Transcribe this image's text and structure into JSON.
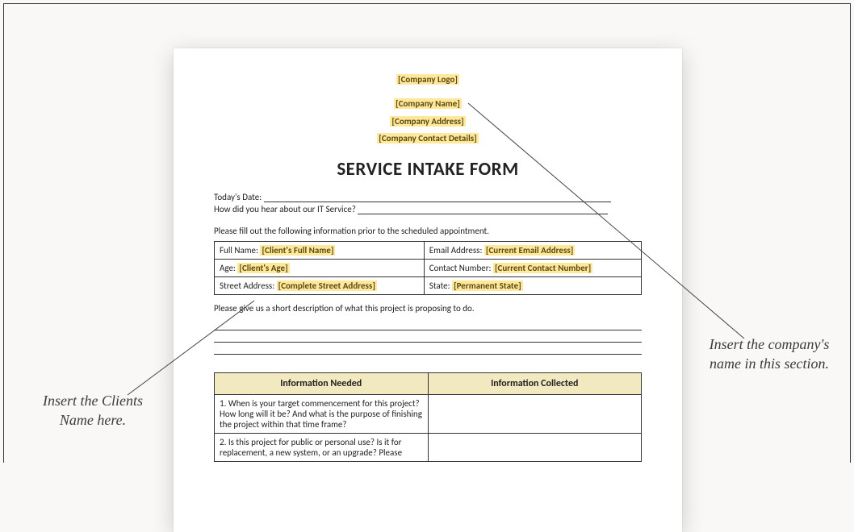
{
  "header": {
    "logo_placeholder": "[Company Logo]",
    "name_placeholder": "[Company Name]",
    "address_placeholder": "[Company Address]",
    "contact_placeholder": "[Company Contact Details]"
  },
  "title": "SERVICE INTAKE FORM",
  "intro": {
    "date_label": "Today's Date:",
    "hear_label": "How did you hear about our IT Service?",
    "fill_instruction": "Please fill out the following information prior to the scheduled appointment."
  },
  "client_table": {
    "full_name_label": "Full Name:",
    "full_name_ph": "[Client's Full Name]",
    "email_label": "Email Address:",
    "email_ph": "[Current Email Address]",
    "age_label": "Age:",
    "age_ph": "[Client's Age]",
    "contact_label": "Contact Number:",
    "contact_ph": "[Current Contact Number]",
    "street_label": "Street Address:",
    "street_ph": "[Complete Street Address]",
    "state_label": "State:",
    "state_ph": "[Permanent State]"
  },
  "description_prompt": "Please give us a short description of what this project is proposing to do.",
  "info_table": {
    "col1": "Information Needed",
    "col2": "Information Collected",
    "rows": [
      "1. When is your target commencement for this project? How long will it be? And what is the purpose of finishing the project within that time frame?",
      "2. Is this project for public or personal use? Is it for replacement, a new system, or an upgrade? Please"
    ]
  },
  "annotations": {
    "left": "Insert the Clients Name here.",
    "right": "Insert the company's name in this section."
  }
}
